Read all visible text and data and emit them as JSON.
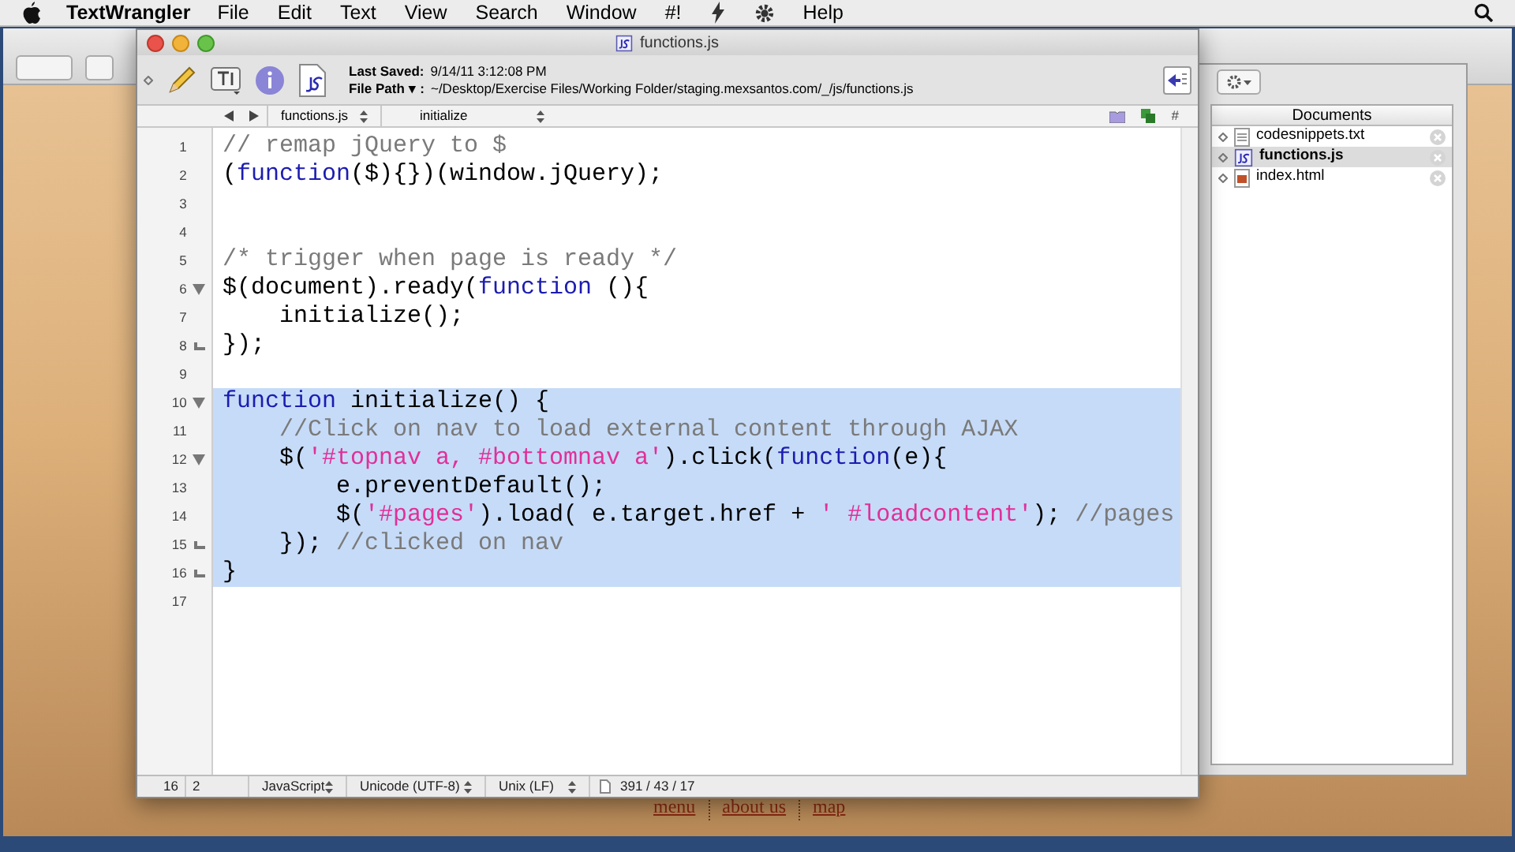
{
  "menubar": {
    "app": "TextWrangler",
    "items": [
      {
        "kind": "text",
        "label": "File"
      },
      {
        "kind": "text",
        "label": "Edit"
      },
      {
        "kind": "text",
        "label": "Text"
      },
      {
        "kind": "text",
        "label": "View"
      },
      {
        "kind": "text",
        "label": "Search"
      },
      {
        "kind": "text",
        "label": "Window"
      },
      {
        "kind": "text",
        "label": "#!"
      },
      {
        "kind": "script_icon"
      },
      {
        "kind": "gear_icon"
      },
      {
        "kind": "text",
        "label": "Help"
      }
    ]
  },
  "window": {
    "title": "functions.js",
    "last_saved_label": "Last Saved:",
    "last_saved": "9/14/11 3:12:08 PM",
    "file_path_label": "File Path ▾ :",
    "file_path": "~/Desktop/Exercise Files/Working Folder/staging.mexsantos.com/_/js/functions.js"
  },
  "navbar": {
    "file": "functions.js",
    "function": "initialize",
    "line_popup": "#"
  },
  "editor": {
    "lines": [
      {
        "number": "1",
        "fold_start": false,
        "fold_end": false,
        "selected": false,
        "tokens": [
          {
            "kind": "comment",
            "text": "// remap jQuery to $"
          }
        ]
      },
      {
        "number": "2",
        "fold_start": false,
        "fold_end": false,
        "selected": false,
        "tokens": [
          {
            "kind": "plain",
            "text": "("
          },
          {
            "kind": "keyword",
            "text": "function"
          },
          {
            "kind": "plain",
            "text": "($){})(window.jQuery);"
          }
        ]
      },
      {
        "number": "3",
        "fold_start": false,
        "fold_end": false,
        "selected": false
      },
      {
        "number": "4",
        "fold_start": false,
        "fold_end": false,
        "selected": false
      },
      {
        "number": "5",
        "fold_start": false,
        "fold_end": false,
        "selected": false,
        "tokens": [
          {
            "kind": "comment",
            "text": "/* trigger when page is ready */"
          }
        ]
      },
      {
        "number": "6",
        "fold_start": true,
        "fold_end": false,
        "selected": false,
        "tokens": [
          {
            "kind": "plain",
            "text": "$(document).ready("
          },
          {
            "kind": "keyword",
            "text": "function"
          },
          {
            "kind": "plain",
            "text": " (){"
          }
        ]
      },
      {
        "number": "7",
        "fold_start": false,
        "fold_end": false,
        "selected": false,
        "tokens": [
          {
            "kind": "plain",
            "text": "    initialize();"
          }
        ]
      },
      {
        "number": "8",
        "fold_start": false,
        "fold_end": true,
        "selected": false,
        "tokens": [
          {
            "kind": "plain",
            "text": "});"
          }
        ]
      },
      {
        "number": "9",
        "fold_start": false,
        "fold_end": false,
        "selected": false
      },
      {
        "number": "10",
        "fold_start": true,
        "fold_end": false,
        "selected": true,
        "tokens": [
          {
            "kind": "keyword",
            "text": "function"
          },
          {
            "kind": "plain",
            "text": " initialize() {"
          }
        ]
      },
      {
        "number": "11",
        "fold_start": false,
        "fold_end": false,
        "selected": true,
        "tokens": [
          {
            "kind": "comment",
            "text": "    //Click on nav to load external content through AJAX"
          }
        ]
      },
      {
        "number": "12",
        "fold_start": true,
        "fold_end": false,
        "selected": true,
        "tokens": [
          {
            "kind": "plain",
            "text": "    $("
          },
          {
            "kind": "string",
            "text": "'#topnav a, #bottomnav a'"
          },
          {
            "kind": "plain",
            "text": ").click("
          },
          {
            "kind": "keyword",
            "text": "function"
          },
          {
            "kind": "plain",
            "text": "(e){"
          }
        ]
      },
      {
        "number": "13",
        "fold_start": false,
        "fold_end": false,
        "selected": true,
        "tokens": [
          {
            "kind": "plain",
            "text": "        e.preventDefault();"
          }
        ]
      },
      {
        "number": "14",
        "fold_start": false,
        "fold_end": false,
        "selected": true,
        "tokens": [
          {
            "kind": "plain",
            "text": "        $("
          },
          {
            "kind": "string",
            "text": "'#pages'"
          },
          {
            "kind": "plain",
            "text": ").load( e.target.href + "
          },
          {
            "kind": "string",
            "text": "' #loadcontent'"
          },
          {
            "kind": "plain",
            "text": "); "
          },
          {
            "kind": "comment",
            "text": "//pages"
          }
        ]
      },
      {
        "number": "15",
        "fold_start": false,
        "fold_end": true,
        "selected": true,
        "tokens": [
          {
            "kind": "plain",
            "text": "    }); "
          },
          {
            "kind": "comment",
            "text": "//clicked on nav"
          }
        ]
      },
      {
        "number": "16",
        "fold_start": false,
        "fold_end": true,
        "selected": true,
        "tokens": [
          {
            "kind": "plain",
            "text": "}"
          }
        ]
      },
      {
        "number": "17",
        "fold_start": false,
        "fold_end": false,
        "selected": false
      }
    ]
  },
  "status_bar": {
    "line": "16",
    "column": "2",
    "language": "JavaScript",
    "encoding": "Unicode (UTF-8)",
    "line_endings": "Unix (LF)",
    "counts": "391 / 43 / 17"
  },
  "drawer": {
    "header": "Documents",
    "documents": [
      {
        "name": "codesnippets.txt",
        "kind": "text",
        "selected": false
      },
      {
        "name": "functions.js",
        "kind": "js",
        "selected": true
      },
      {
        "name": "index.html",
        "kind": "html",
        "selected": false
      }
    ]
  },
  "footer_links": [
    "menu",
    "about us",
    "map"
  ]
}
